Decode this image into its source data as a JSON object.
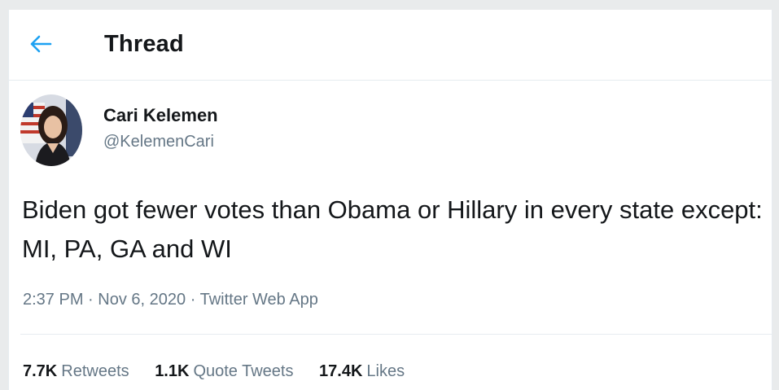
{
  "header": {
    "back_icon": "arrow-left-icon",
    "title": "Thread"
  },
  "tweet": {
    "author": {
      "name": "Cari Kelemen",
      "handle": "@KelemenCari"
    },
    "text": "Biden got fewer votes than Obama or Hillary in every state except: MI, PA, GA and WI",
    "time": "2:37 PM",
    "separator": "·",
    "date": "Nov 6, 2020",
    "source": "Twitter Web App"
  },
  "stats": {
    "retweets_count": "7.7K",
    "retweets_label": "Retweets",
    "quotes_count": "1.1K",
    "quotes_label": "Quote Tweets",
    "likes_count": "17.4K",
    "likes_label": "Likes"
  },
  "colors": {
    "accent": "#1da1f2",
    "text": "#14171a",
    "secondary": "#657786",
    "border": "#e6ecf0"
  }
}
